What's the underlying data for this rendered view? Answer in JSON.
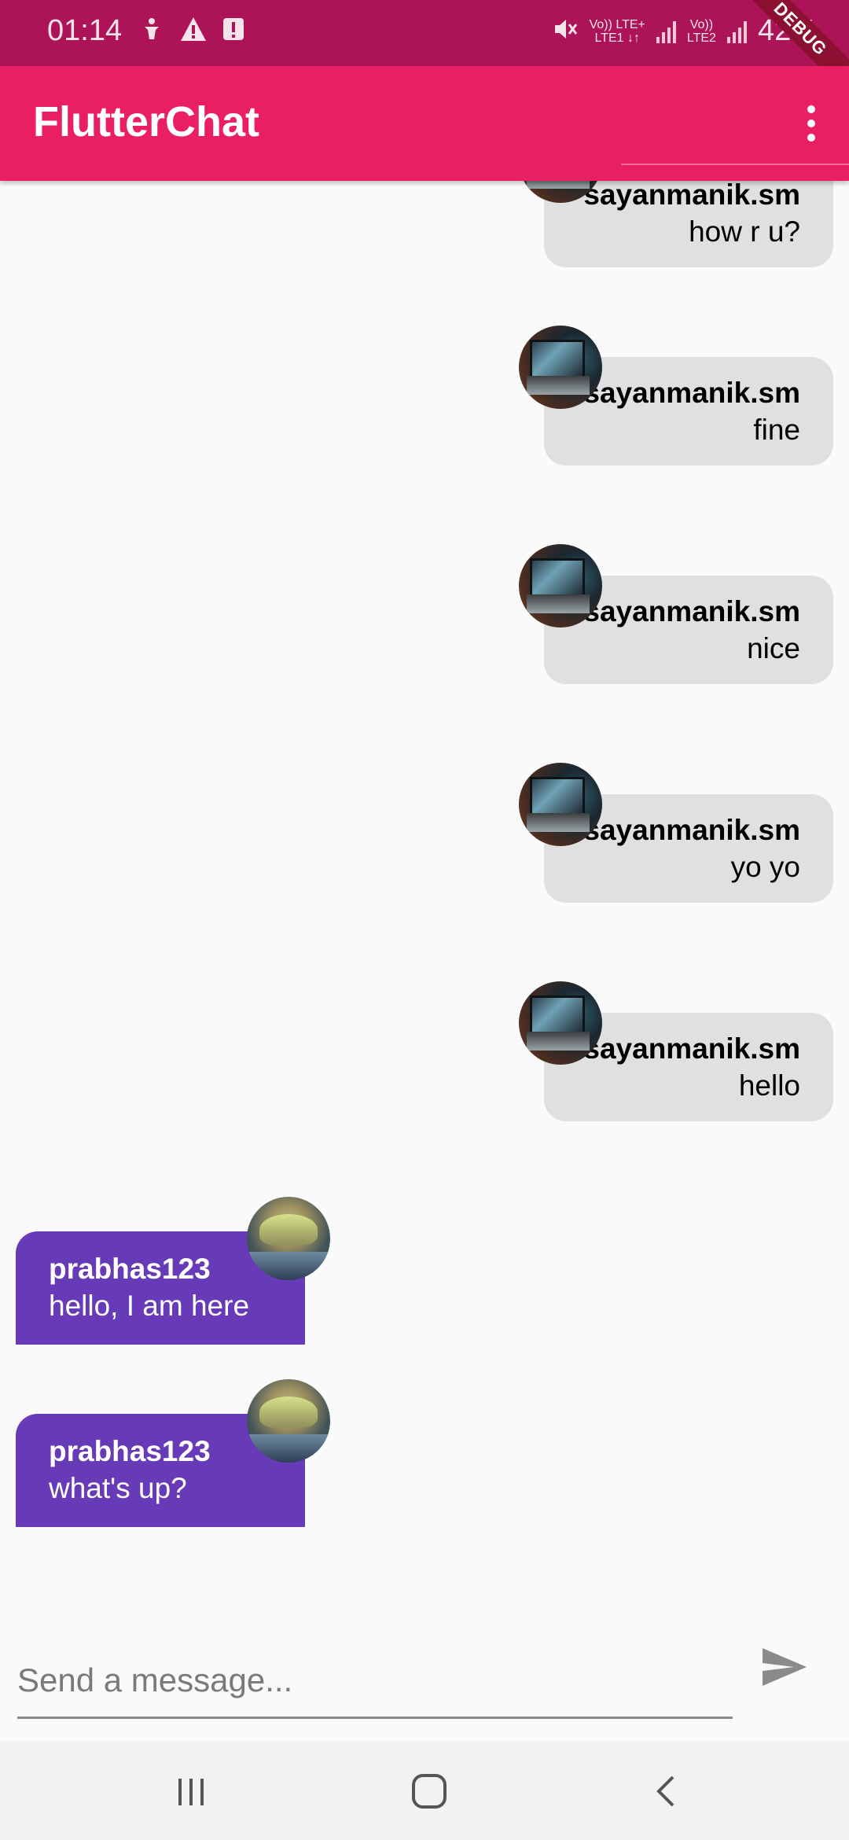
{
  "status_bar": {
    "time": "01:14",
    "sim1_label": "Vo)) LTE+",
    "sim1_sub": "LTE1 ↓↑",
    "sim2_label": "Vo))",
    "sim2_sub": "LTE2",
    "battery": "42%",
    "debug_label": "DEBUG",
    "color": "#ad1457"
  },
  "app_bar": {
    "title": "FlutterChat",
    "color": "#e91e63"
  },
  "messages": [
    {
      "user": "sayanmanik.sm",
      "text": "how r u?",
      "is_me": true,
      "avatar": "laptop-avatar"
    },
    {
      "user": "sayanmanik.sm",
      "text": "fine",
      "is_me": true,
      "avatar": "laptop-avatar"
    },
    {
      "user": "sayanmanik.sm",
      "text": "nice",
      "is_me": true,
      "avatar": "laptop-avatar"
    },
    {
      "user": "sayanmanik.sm",
      "text": "yo yo",
      "is_me": true,
      "avatar": "laptop-avatar"
    },
    {
      "user": "sayanmanik.sm",
      "text": "hello",
      "is_me": true,
      "avatar": "laptop-avatar"
    },
    {
      "user": "prabhas123",
      "text": "hello, I am here",
      "is_me": false,
      "avatar": "hat-avatar"
    },
    {
      "user": "prabhas123",
      "text": "what's up?",
      "is_me": false,
      "avatar": "hat-avatar"
    }
  ],
  "colors": {
    "my_bubble": "#e0e0e0",
    "other_bubble": "#673ab7"
  },
  "composer": {
    "placeholder": "Send a message...",
    "value": "",
    "send_icon": "send-icon"
  },
  "nav_bar": {
    "recents_icon": "recents-icon",
    "home_icon": "home-icon",
    "back_icon": "back-icon"
  }
}
